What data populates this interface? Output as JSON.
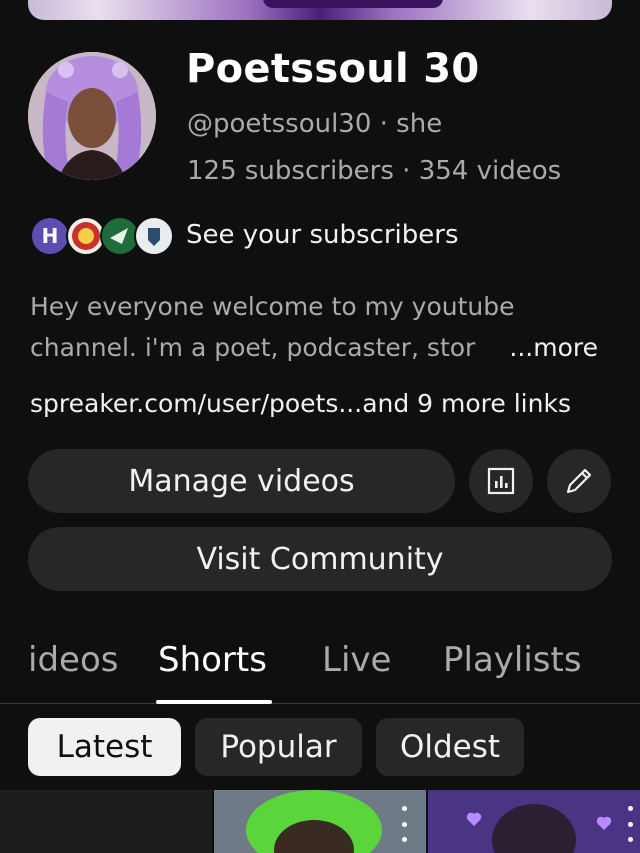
{
  "channel": {
    "name": "Poetssoul 30",
    "handle": "@poetssoul30 · she",
    "stats": "125 subscribers · 354 videos"
  },
  "subscribers_preview": {
    "first_initial": "H",
    "label": "See your subscribers"
  },
  "description": {
    "line1": "Hey everyone welcome to my youtube",
    "line2": "channel. i'm a poet, podcaster, stor",
    "more": "...more"
  },
  "links": {
    "primary": "spreaker.com/user/poets...",
    "extra": "and 9 more links"
  },
  "buttons": {
    "manage": "Manage videos",
    "stats_icon": "bar-chart-icon",
    "edit_icon": "pencil-icon",
    "visit": "Visit Community"
  },
  "tabs": [
    {
      "label": "ideos",
      "active": false
    },
    {
      "label": "Shorts",
      "active": true
    },
    {
      "label": "Live",
      "active": false
    },
    {
      "label": "Playlists",
      "active": false
    }
  ],
  "chips": [
    {
      "label": "Latest",
      "selected": true
    },
    {
      "label": "Popular",
      "selected": false
    },
    {
      "label": "Oldest",
      "selected": false
    }
  ],
  "colors": {
    "background": "#0f0f0f",
    "button": "#272727",
    "text_secondary": "#aaaaaa",
    "accent_purple": "#9b6fc0"
  }
}
